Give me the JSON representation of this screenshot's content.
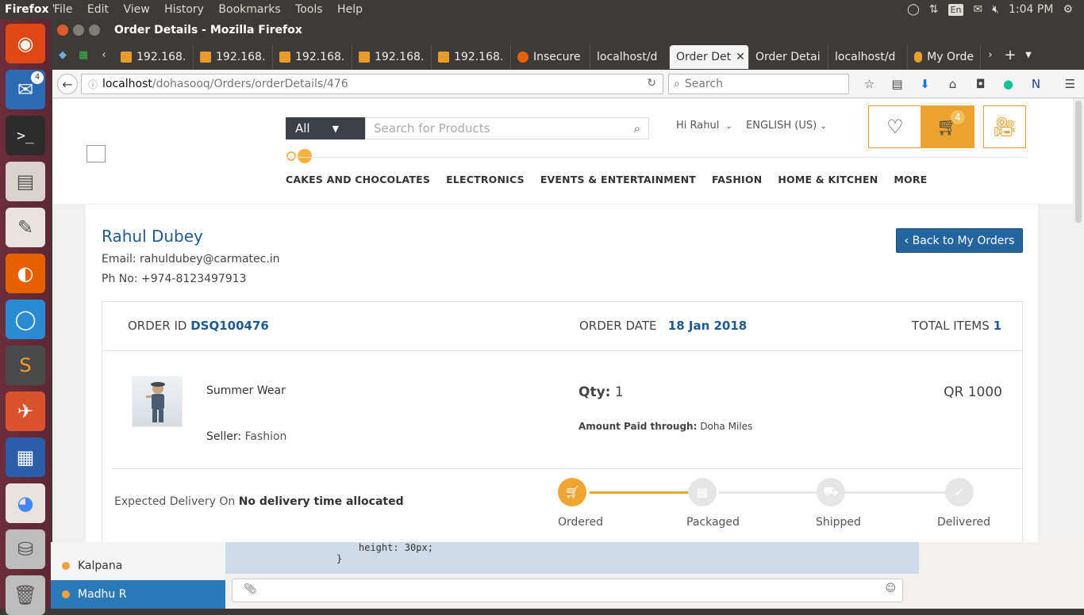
{
  "topbar": {
    "app": "Firefox Web Browser",
    "menu": [
      "File",
      "Edit",
      "View",
      "History",
      "Bookmarks",
      "Tools",
      "Help"
    ],
    "lang": "En",
    "time": "1:04 PM"
  },
  "launcher": {
    "thunderbird_badge": "4"
  },
  "window": {
    "title": "Order Details - Mozilla Firefox"
  },
  "tabs": [
    {
      "label": "192.168."
    },
    {
      "label": "192.168."
    },
    {
      "label": "192.168."
    },
    {
      "label": "192.168."
    },
    {
      "label": "192.168."
    },
    {
      "label": "Insecure"
    },
    {
      "label": "localhost/d"
    },
    {
      "label": "Order Det",
      "active": true
    },
    {
      "label": "Order Detai"
    },
    {
      "label": "localhost/d"
    },
    {
      "label": "My Orde"
    }
  ],
  "nav": {
    "url_host": "localhost",
    "url_path": "/dohasooq/Orders/orderDetails/476",
    "search_placeholder": "Search"
  },
  "site": {
    "category": "All",
    "search_placeholder": "Search for Products",
    "greeting": "Hi Rahul",
    "language": "ENGLISH (US)",
    "cart_count": "4",
    "categories": [
      "CAKES AND CHOCOLATES",
      "ELECTRONICS",
      "EVENTS & ENTERTAINMENT",
      "FASHION",
      "HOME & KITCHEN",
      "MORE"
    ]
  },
  "customer": {
    "name": "Rahul Dubey",
    "email_label": "Email:",
    "email": "rahuldubey@carmatec.in",
    "phone_label": "Ph No:",
    "phone": "+974-8123497913"
  },
  "back_button": "‹ Back to My Orders",
  "order": {
    "id_label": "ORDER ID",
    "id": "DSQ100476",
    "date_label": "ORDER DATE",
    "date": "18 Jan 2018",
    "items_label": "TOTAL ITEMS",
    "items": "1",
    "product_name": "Summer Wear",
    "seller_label": "Seller:",
    "seller": "Fashion",
    "qty_label": "Qty:",
    "qty": "1",
    "paid_label": "Amount Paid through:",
    "paid_via": "Doha Miles",
    "price": "QR 1000",
    "delivery_label": "Expected Delivery On",
    "delivery_value": "No delivery time allocated",
    "steps": [
      {
        "label": "Ordered",
        "done": true
      },
      {
        "label": "Packaged",
        "done": false
      },
      {
        "label": "Shipped",
        "done": false
      },
      {
        "label": "Delivered",
        "done": false
      }
    ]
  },
  "chat": {
    "contacts": [
      {
        "name": "Kalpana"
      },
      {
        "name": "Madhu R",
        "active": true
      }
    ],
    "code_line1": "height: 30px;",
    "code_line2": "}"
  },
  "colors": {
    "accent": "#f0a530",
    "brand_blue": "#1e5a8f",
    "button_blue": "#2465a0",
    "launcher": "#5d2733"
  }
}
